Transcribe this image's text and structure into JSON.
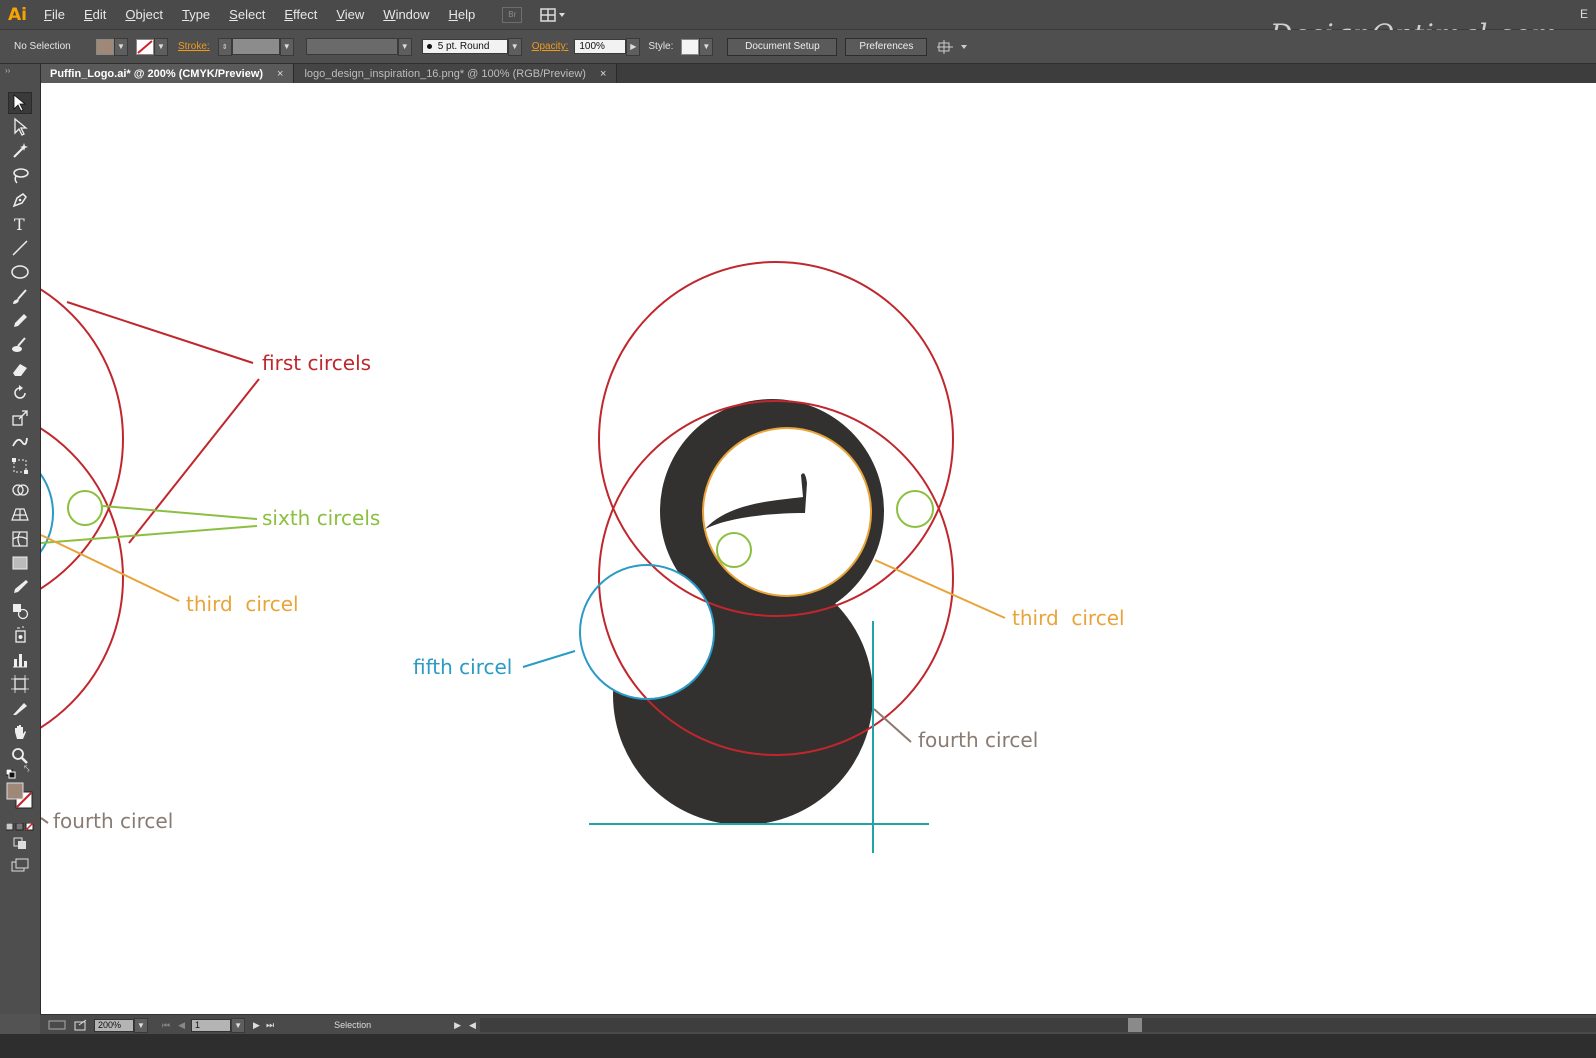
{
  "menubar": {
    "app_logo": "Ai",
    "items": [
      {
        "label": "File",
        "u": "F",
        "rest": "ile"
      },
      {
        "label": "Edit",
        "u": "E",
        "rest": "dit"
      },
      {
        "label": "Object",
        "u": "O",
        "rest": "bject"
      },
      {
        "label": "Type",
        "u": "T",
        "rest": "ype"
      },
      {
        "label": "Select",
        "u": "S",
        "rest": "elect"
      },
      {
        "label": "Effect",
        "u": "E",
        "rest": "ffect"
      },
      {
        "label": "View",
        "u": "V",
        "rest": "iew"
      },
      {
        "label": "Window",
        "u": "W",
        "rest": "indow"
      },
      {
        "label": "Help",
        "u": "H",
        "rest": "elp"
      }
    ],
    "bridge_button": "Br",
    "right_text": "E",
    "watermark": "DesignOptimal.com"
  },
  "controlbar": {
    "selection_status": "No Selection",
    "fill_color": "#a08878",
    "stroke_label": "Stroke:",
    "brush_label": "5 pt. Round",
    "opacity_label": "Opacity:",
    "opacity_value": "100%",
    "style_label": "Style:",
    "document_setup_label": "Document Setup",
    "preferences_label": "Preferences"
  },
  "tabs": [
    {
      "label": "Puffin_Logo.ai* @ 200% (CMYK/Preview)",
      "active": true
    },
    {
      "label": "logo_design_inspiration_16.png* @ 100% (RGB/Preview)",
      "active": false
    }
  ],
  "tabs_close_glyph": "×",
  "tools": [
    "selection-tool-icon",
    "direct-selection-tool-icon",
    "magic-wand-tool-icon",
    "lasso-tool-icon",
    "pen-tool-icon",
    "type-tool-icon",
    "line-segment-tool-icon",
    "ellipse-tool-icon",
    "paintbrush-tool-icon",
    "pencil-tool-icon",
    "blob-brush-tool-icon",
    "eraser-tool-icon",
    "rotate-tool-icon",
    "scale-tool-icon",
    "warp-tool-icon",
    "free-transform-tool-icon",
    "shape-builder-tool-icon",
    "perspective-grid-tool-icon",
    "mesh-tool-icon",
    "gradient-tool-icon",
    "eyedropper-tool-icon",
    "blend-tool-icon",
    "symbol-sprayer-tool-icon",
    "column-graph-tool-icon",
    "artboard-tool-icon",
    "slice-tool-icon",
    "hand-tool-icon",
    "zoom-tool-icon"
  ],
  "artboard": {
    "colors": {
      "first": "#c0272d",
      "third": "#e8a43a",
      "fifth": "#2a9bc4",
      "sixth": "#8bbf3f",
      "fourth": "#8a7b72",
      "guide": "#22a3a8",
      "shape": "#333030"
    },
    "labels": {
      "first_circels": "first circels",
      "sixth_circels": "sixth circels",
      "third_circel_left": "third  circel",
      "third_circel_right": "third  circel",
      "fifth_circel": "fifth circel",
      "fourth_circel_right": "fourth circel",
      "fourth_circel_left": "fourth circel"
    }
  },
  "statusbar": {
    "zoom_value": "200%",
    "artboard_number": "1",
    "status_text": "Selection"
  }
}
